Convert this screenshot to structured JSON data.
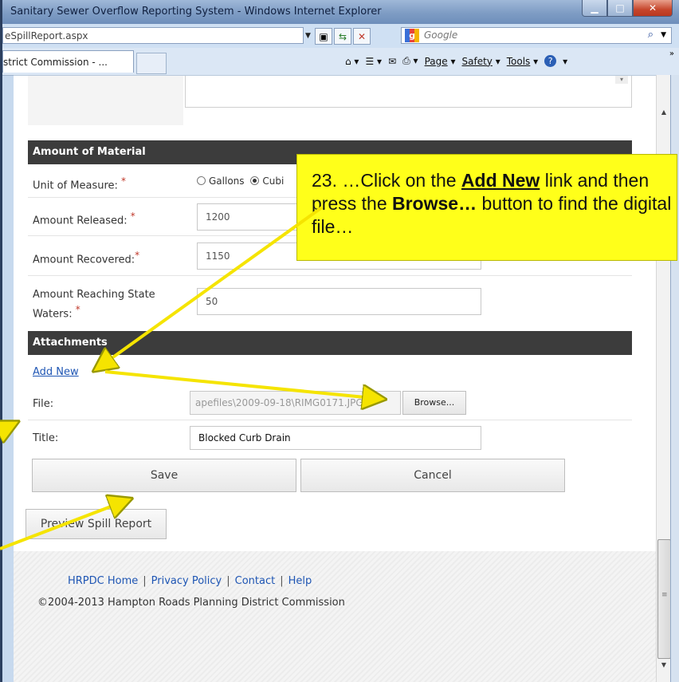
{
  "window": {
    "title": "Sanitary Sewer Overflow Reporting System - Windows Internet Explorer",
    "minimize_icon": "minimize-icon",
    "maximize_icon": "maximize-icon",
    "close_icon": "close-icon"
  },
  "address": {
    "url": "eSpillReport.aspx",
    "search_placeholder": "Google"
  },
  "tab": {
    "label": "strict Commission - ..."
  },
  "toolbar": {
    "page": "Page",
    "safety": "Safety",
    "tools": "Tools"
  },
  "sections": {
    "amount": "Amount of Material",
    "attachments": "Attachments"
  },
  "fields": {
    "unit_label": "Unit of Measure:",
    "unit_options": [
      "Gallons",
      "Cubi"
    ],
    "unit_selected": "Cubi",
    "released_label": "Amount Released:",
    "released_value": "1200",
    "recovered_label": "Amount Recovered:",
    "recovered_value": "1150",
    "reaching_label_1": "Amount Reaching State",
    "reaching_label_2": "Waters:",
    "reaching_value": "50",
    "required_mark": "*"
  },
  "attachments": {
    "add_new": "Add New",
    "file_label": "File:",
    "file_value": "apefiles\\2009-09-18\\RIMG0171.JPG",
    "browse": "Browse...",
    "title_label": "Title:",
    "title_value": "Blocked Curb Drain"
  },
  "buttons": {
    "save": "Save",
    "cancel": "Cancel",
    "preview": "Preview Spill Report"
  },
  "footer": {
    "links": [
      "HRPDC Home",
      "Privacy Policy",
      "Contact",
      "Help"
    ],
    "copyright": "©2004-2013 Hampton Roads Planning District Commission"
  },
  "callout": {
    "prefix": "23. …Click on the ",
    "link_word": "Add New",
    "mid": " link and then press the ",
    "bold_word": "Browse…",
    "suffix": " button to find the digital file…"
  },
  "colors": {
    "callout": "#ffff1a",
    "arrow": "#f5e400",
    "section_header": "#3c3c3c",
    "link": "#1f56b4",
    "required": "#c0392b"
  }
}
